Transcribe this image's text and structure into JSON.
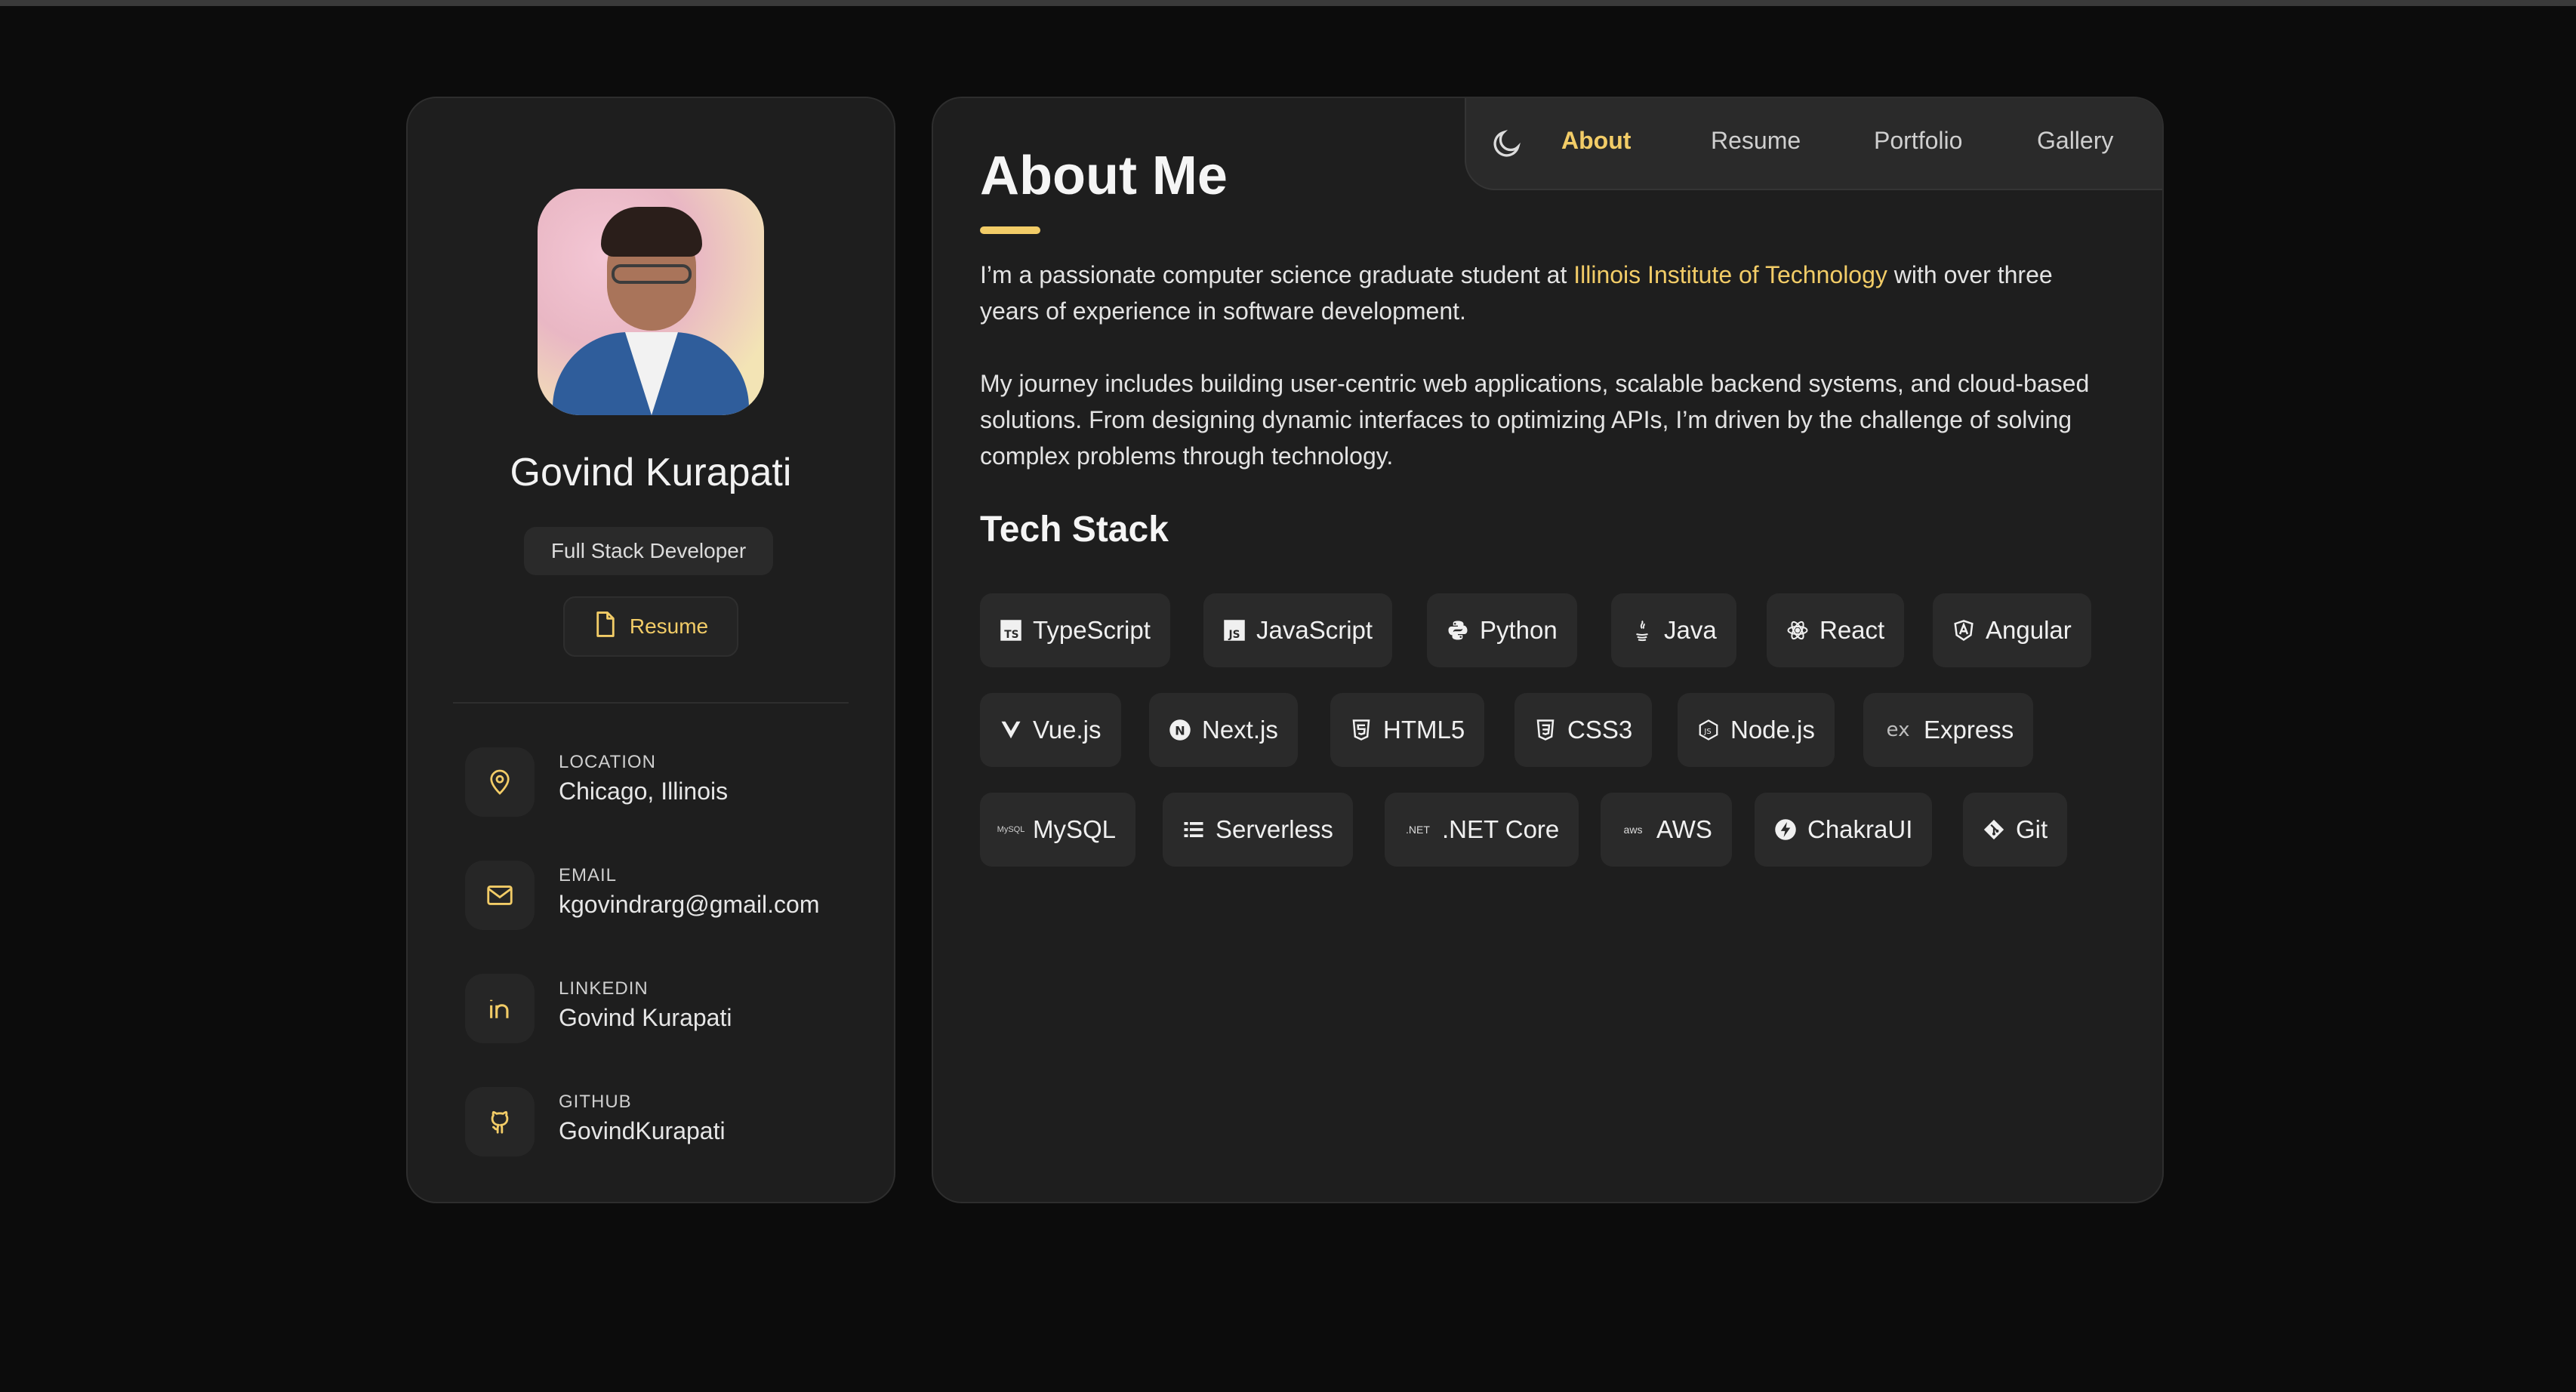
{
  "profile": {
    "name": "Govind Kurapati",
    "role": "Full Stack Developer",
    "resume_label": "Resume"
  },
  "contacts": [
    {
      "label": "LOCATION",
      "value": "Chicago, Illinois",
      "icon": "map-pin-icon"
    },
    {
      "label": "EMAIL",
      "value": "kgovindrarg@gmail.com",
      "icon": "mail-icon"
    },
    {
      "label": "LINKEDIN",
      "value": "Govind Kurapati",
      "icon": "linkedin-icon"
    },
    {
      "label": "GITHUB",
      "value": "GovindKurapati",
      "icon": "github-icon"
    }
  ],
  "nav": {
    "theme_icon": "moon-icon",
    "tabs": [
      "About",
      "Resume",
      "Portfolio",
      "Gallery"
    ],
    "active": "About"
  },
  "about": {
    "title": "About Me",
    "p1_before": "I’m a passionate computer science graduate student at ",
    "p1_highlight": "Illinois Institute of Technology",
    "p1_after": " with over three years of experience in software development.",
    "p2": "My journey includes building user-centric web applications, scalable backend systems, and cloud-based solutions. From designing dynamic interfaces to optimizing APIs, I’m driven by the challenge of solving complex problems through technology."
  },
  "tech_stack": {
    "title": "Tech Stack",
    "items": [
      {
        "label": "TypeScript",
        "icon": "typescript-icon"
      },
      {
        "label": "JavaScript",
        "icon": "javascript-icon"
      },
      {
        "label": "Python",
        "icon": "python-icon"
      },
      {
        "label": "Java",
        "icon": "java-icon"
      },
      {
        "label": "React",
        "icon": "react-icon"
      },
      {
        "label": "Angular",
        "icon": "angular-icon"
      },
      {
        "label": "Vue.js",
        "icon": "vue-icon"
      },
      {
        "label": "Next.js",
        "icon": "nextjs-icon"
      },
      {
        "label": "HTML5",
        "icon": "html5-icon"
      },
      {
        "label": "CSS3",
        "icon": "css3-icon"
      },
      {
        "label": "Node.js",
        "icon": "nodejs-icon"
      },
      {
        "label": "Express",
        "icon": "express-icon"
      },
      {
        "label": "MySQL",
        "icon": "mysql-icon"
      },
      {
        "label": "Serverless",
        "icon": "serverless-icon"
      },
      {
        "label": ".NET Core",
        "icon": "dotnet-icon"
      },
      {
        "label": "AWS",
        "icon": "aws-icon"
      },
      {
        "label": "ChakraUI",
        "icon": "chakraui-icon"
      },
      {
        "label": "Git",
        "icon": "git-icon"
      }
    ]
  },
  "colors": {
    "accent": "#f2cc67",
    "card": "#1e1e1e",
    "background": "#0c0c0c"
  }
}
